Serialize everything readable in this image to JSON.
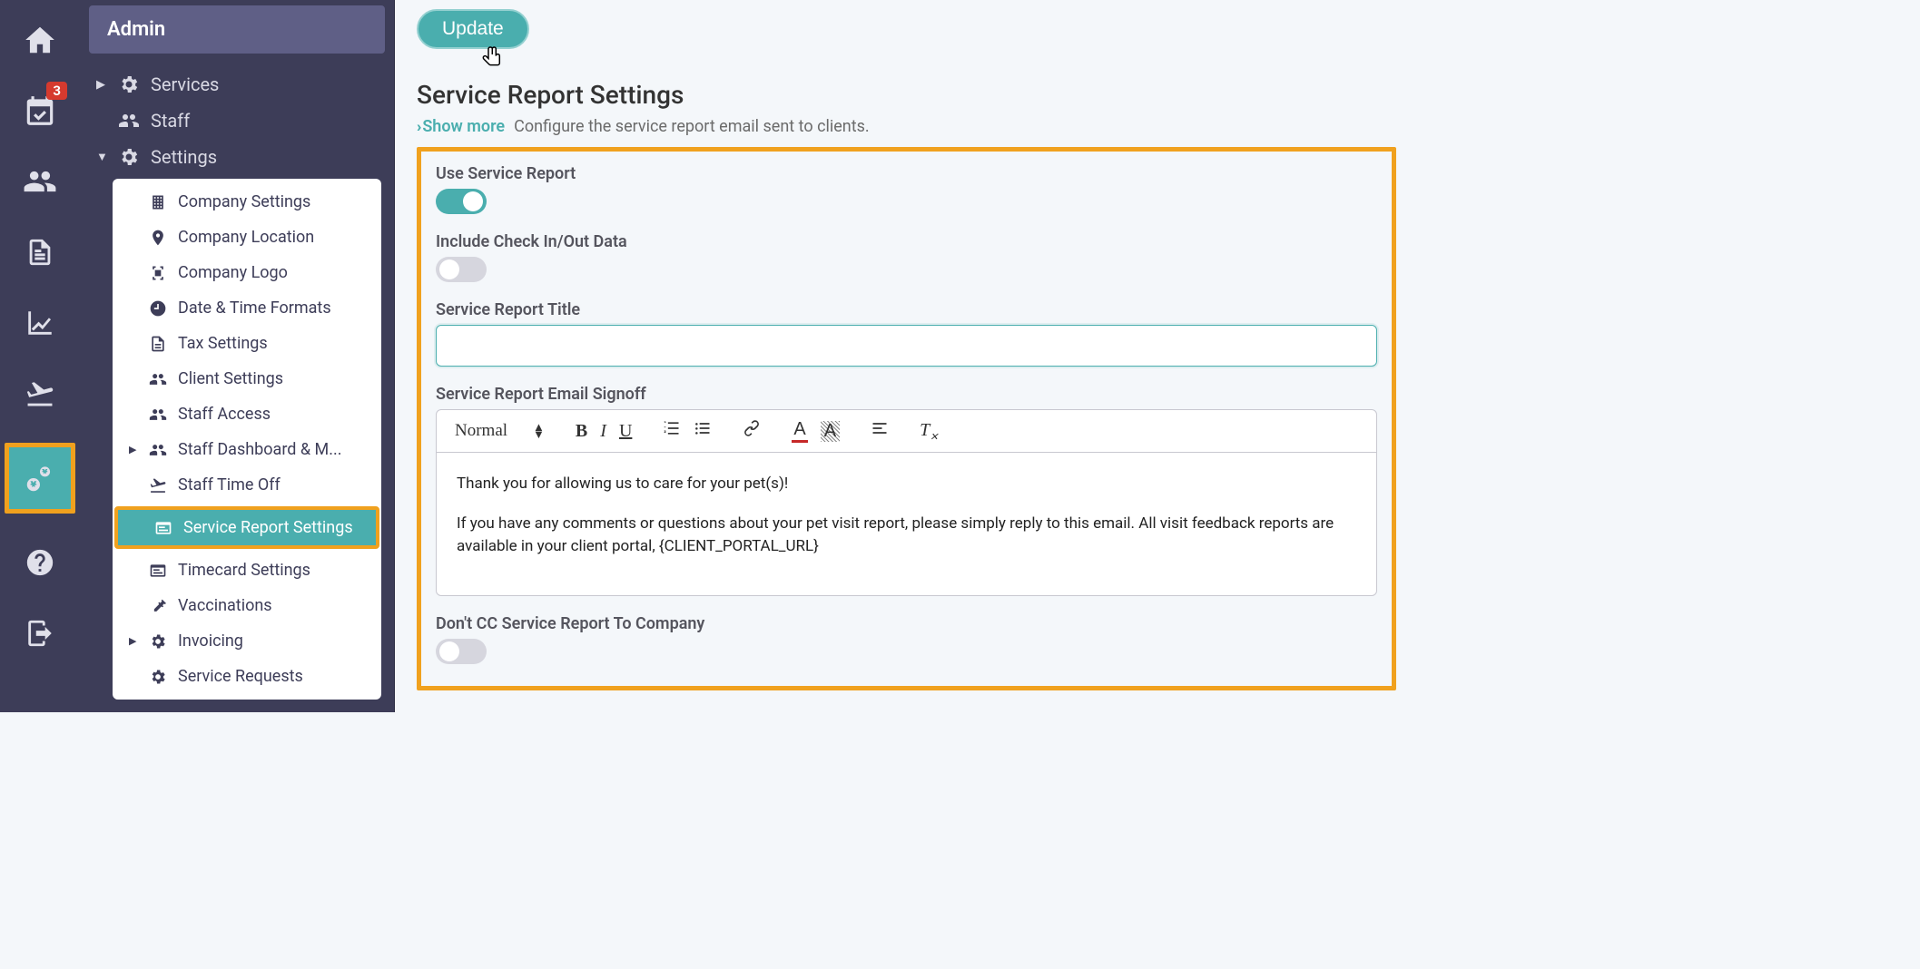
{
  "rail": {
    "badge_count": "3"
  },
  "sidebar": {
    "header": "Admin",
    "items": {
      "services": "Services",
      "staff": "Staff",
      "settings": "Settings"
    },
    "settings_sub": {
      "company_settings": "Company Settings",
      "company_location": "Company Location",
      "company_logo": "Company Logo",
      "date_time": "Date & Time Formats",
      "tax": "Tax Settings",
      "client": "Client Settings",
      "staff_access": "Staff Access",
      "staff_dashboard": "Staff Dashboard & M...",
      "staff_time_off": "Staff Time Off",
      "service_report": "Service Report Settings",
      "timecard": "Timecard Settings",
      "vaccinations": "Vaccinations",
      "invoicing": "Invoicing",
      "service_requests": "Service Requests"
    }
  },
  "main": {
    "update_btn": "Update",
    "title": "Service Report Settings",
    "show_more": "Show more",
    "description": "Configure the service report email sent to clients.",
    "use_service_report_label": "Use Service Report",
    "use_service_report_on": true,
    "include_checkin_label": "Include Check In/Out Data",
    "include_checkin_on": false,
    "title_field_label": "Service Report Title",
    "title_field_value": "",
    "signoff_label": "Service Report Email Signoff",
    "editor": {
      "format": "Normal",
      "line1": "Thank you for allowing us to care for your pet(s)!",
      "line2": "If you have any comments or questions about your pet visit report, please simply reply to this email. All visit feedback reports are available in your client portal, {CLIENT_PORTAL_URL}"
    },
    "dont_cc_label": "Don't CC Service Report To Company",
    "dont_cc_on": false
  }
}
